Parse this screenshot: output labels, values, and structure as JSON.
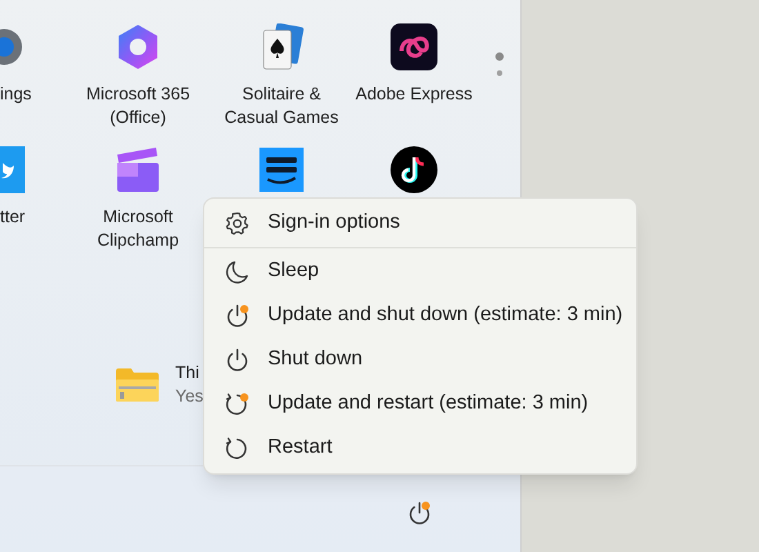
{
  "apps": [
    {
      "label": "ings"
    },
    {
      "label": "Microsoft 365\n(Office)"
    },
    {
      "label": "Solitaire &\nCasual Games"
    },
    {
      "label": "Adobe Express"
    },
    {
      "label": "tter"
    },
    {
      "label": "Microsoft\nClipchamp"
    }
  ],
  "page_dots": [
    {
      "selected": true
    },
    {
      "selected": false
    }
  ],
  "recommended": [
    {
      "title": "Thi",
      "subtitle": "Yes"
    }
  ],
  "power_menu": [
    {
      "kind": "settings",
      "label": "Sign-in options",
      "badge": false
    },
    {
      "kind": "sleep",
      "label": "Sleep",
      "badge": false
    },
    {
      "kind": "power",
      "label": "Update and shut down (estimate: 3 min)",
      "badge": true
    },
    {
      "kind": "power",
      "label": "Shut down",
      "badge": false
    },
    {
      "kind": "restart",
      "label": "Update and restart (estimate: 3 min)",
      "badge": true
    },
    {
      "kind": "restart",
      "label": "Restart",
      "badge": false
    }
  ],
  "power_button": {
    "badge": true
  }
}
